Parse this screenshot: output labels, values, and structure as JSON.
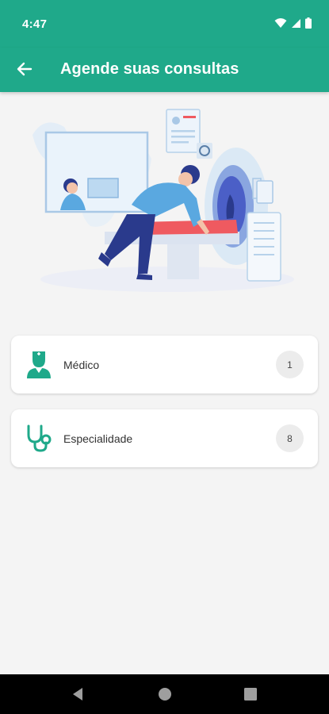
{
  "status_bar": {
    "time": "4:47",
    "icons": [
      "wifi-icon",
      "signal-icon",
      "battery-icon"
    ]
  },
  "app_bar": {
    "title": "Agende suas consultas",
    "back_icon": "arrow-left-icon"
  },
  "illustration": {
    "icon": "mri-scan-illustration"
  },
  "options": [
    {
      "label": "Médico",
      "count": "1",
      "icon": "doctor-icon"
    },
    {
      "label": "Especialidade",
      "count": "8",
      "icon": "stethoscope-icon"
    }
  ],
  "navigation": {
    "icons": [
      "nav-back-icon",
      "nav-home-icon",
      "nav-recents-icon"
    ]
  },
  "colors": {
    "primary": "#1fa98a",
    "background": "#f4f4f4",
    "badge": "#ececec",
    "illustration_blue": "#5aa8e0",
    "illustration_navy": "#2a3a8c",
    "illustration_red": "#ef5a60"
  }
}
